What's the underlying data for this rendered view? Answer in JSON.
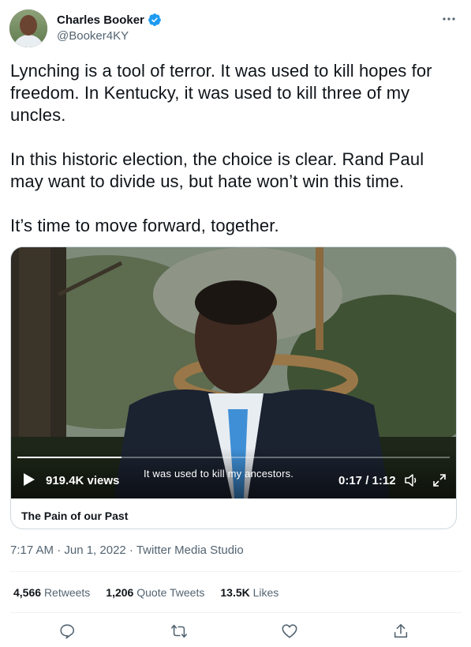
{
  "author": {
    "name": "Charles Booker",
    "handle": "@Booker4KY",
    "verified": true
  },
  "tweet": {
    "text": "Lynching is a tool of terror. It was used to kill hopes for freedom. In Kentucky, it was used to kill three of my uncles.\n\nIn this historic election, the choice is clear. Rand Paul may want to divide us, but hate won’t win this time.\n\nIt’s time to move forward, together."
  },
  "media": {
    "views": "919.4K views",
    "subtitle": "It was used to kill my ancestors.",
    "time": "0:17 / 1:12",
    "progress_fraction": 0.24,
    "title": "The Pain of our Past"
  },
  "meta": {
    "timestamp": "7:17 AM · Jun 1, 2022 · Twitter Media Studio"
  },
  "stats": {
    "retweets_count": "4,566",
    "retweets_label": "Retweets",
    "quotes_count": "1,206",
    "quotes_label": "Quote Tweets",
    "likes_count": "13.5K",
    "likes_label": "Likes"
  },
  "colors": {
    "verified": "#1d9bf0",
    "secondary_text": "#536471",
    "primary_text": "#0f1419"
  },
  "icons": [
    "more-icon",
    "verified-icon",
    "play-icon",
    "volume-icon",
    "expand-icon",
    "reply-icon",
    "retweet-icon",
    "like-icon",
    "share-icon"
  ]
}
